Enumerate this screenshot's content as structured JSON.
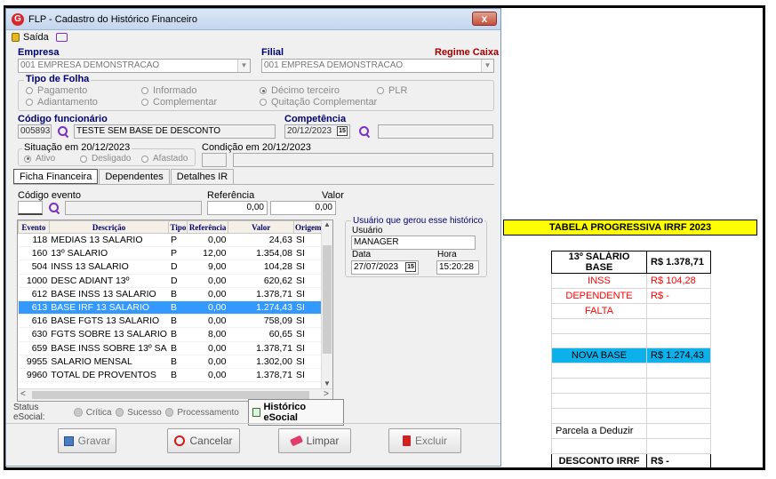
{
  "window": {
    "title": "FLP - Cadastro do Histórico Financeiro",
    "close": "x"
  },
  "toolbar": {
    "exit_label": "Saída"
  },
  "empresa": {
    "label": "Empresa",
    "value": "001 EMPRESA DEMONSTRACAO"
  },
  "filial": {
    "label": "Filial",
    "value": "001 EMPRESA DEMONSTRACAO",
    "regime": "Regime Caixa"
  },
  "tipo_folha": {
    "label": "Tipo de Folha",
    "options": [
      "Pagamento",
      "Informado",
      "Décimo terceiro",
      "PLR",
      "Adiantamento",
      "Complementar",
      "Quitação Complementar"
    ],
    "selected": "Décimo terceiro"
  },
  "funcionario": {
    "label": "Código funcionário",
    "code": "005893",
    "name": "TESTE SEM BASE DE DESCONTO"
  },
  "competencia": {
    "label": "Competência",
    "value": "20/12/2023",
    "cal": "15"
  },
  "situacao": {
    "label": "Situação em 20/12/2023",
    "options": [
      "Ativo",
      "Desligado",
      "Afastado"
    ],
    "selected": "Ativo"
  },
  "condicao": {
    "label": "Condição em 20/12/2023"
  },
  "tabs": [
    "Ficha Financeira",
    "Dependentes",
    "Detalhes IR"
  ],
  "evento_form": {
    "codigo_label": "Código evento",
    "referencia_label": "Referência",
    "referencia_value": "0,00",
    "valor_label": "Valor",
    "valor_value": "0,00"
  },
  "grid": {
    "headers": [
      "Evento",
      "Descrição",
      "Tipo",
      "Referência",
      "Valor",
      "Origem"
    ],
    "rows": [
      [
        "118",
        "MEDIAS 13 SALARIO",
        "P",
        "0,00",
        "24,63",
        "SI"
      ],
      [
        "160",
        "13º SALARIO",
        "P",
        "12,00",
        "1.354,08",
        "SI"
      ],
      [
        "504",
        "INSS 13 SALARIO",
        "D",
        "9,00",
        "104,28",
        "SI"
      ],
      [
        "1000",
        "DESC ADIANT 13º",
        "D",
        "0,00",
        "620,62",
        "SI"
      ],
      [
        "612",
        "BASE INSS 13 SALARIO",
        "B",
        "0,00",
        "1.378,71",
        "SI"
      ],
      [
        "613",
        "BASE IRF 13 SALARIO",
        "B",
        "0,00",
        "1.274,43",
        "SI"
      ],
      [
        "616",
        "BASE FGTS 13 SALARIO",
        "B",
        "0,00",
        "758,09",
        "SI"
      ],
      [
        "630",
        "FGTS SOBRE 13 SALARIO",
        "B",
        "8,00",
        "60,65",
        "SI"
      ],
      [
        "659",
        "BASE INSS SOBRE 13º SA",
        "B",
        "0,00",
        "1.378,71",
        "SI"
      ],
      [
        "9955",
        "SALARIO MENSAL",
        "B",
        "0,00",
        "1.302,00",
        "SI"
      ],
      [
        "9960",
        "TOTAL DE PROVENTOS",
        "B",
        "0,00",
        "1.378,71",
        "SI"
      ]
    ],
    "selected_index": 5
  },
  "usuario_box": {
    "title": "Usuário que gerou esse histórico",
    "usuario_label": "Usuário",
    "usuario_value": "MANAGER",
    "data_label": "Data",
    "data_value": "27/07/2023",
    "hora_label": "Hora",
    "hora_value": "15:20:28"
  },
  "status": {
    "label": "Status eSocial:",
    "items": [
      "Crítica",
      "Sucesso",
      "Processamento"
    ],
    "historico": "Histórico eSocial"
  },
  "buttons": {
    "gravar": "Gravar",
    "cancelar": "Cancelar",
    "limpar": "Limpar",
    "excluir": "Excluir"
  },
  "sheet": {
    "title": "TABELA PROGRESSIVA IRRF 2023",
    "rows": [
      {
        "label": "13º SALÁRIO BASE",
        "value": "R$ 1.378,71"
      },
      {
        "label": "INSS",
        "value": "R$ 104,28"
      },
      {
        "label": "DEPENDENTE",
        "value": "R$ -"
      },
      {
        "label": "FALTA",
        "value": ""
      },
      {
        "label": "",
        "value": ""
      },
      {
        "label": "",
        "value": ""
      },
      {
        "label": "NOVA BASE",
        "value": "R$ 1.274,43"
      },
      {
        "label": "",
        "value": ""
      },
      {
        "label": "",
        "value": ""
      },
      {
        "label": "",
        "value": ""
      },
      {
        "label": "",
        "value": ""
      },
      {
        "label": "Parcela a Deduzir",
        "value": ""
      },
      {
        "label": "",
        "value": ""
      },
      {
        "label": "DESCONTO IRRF",
        "value": "R$ -"
      }
    ]
  }
}
